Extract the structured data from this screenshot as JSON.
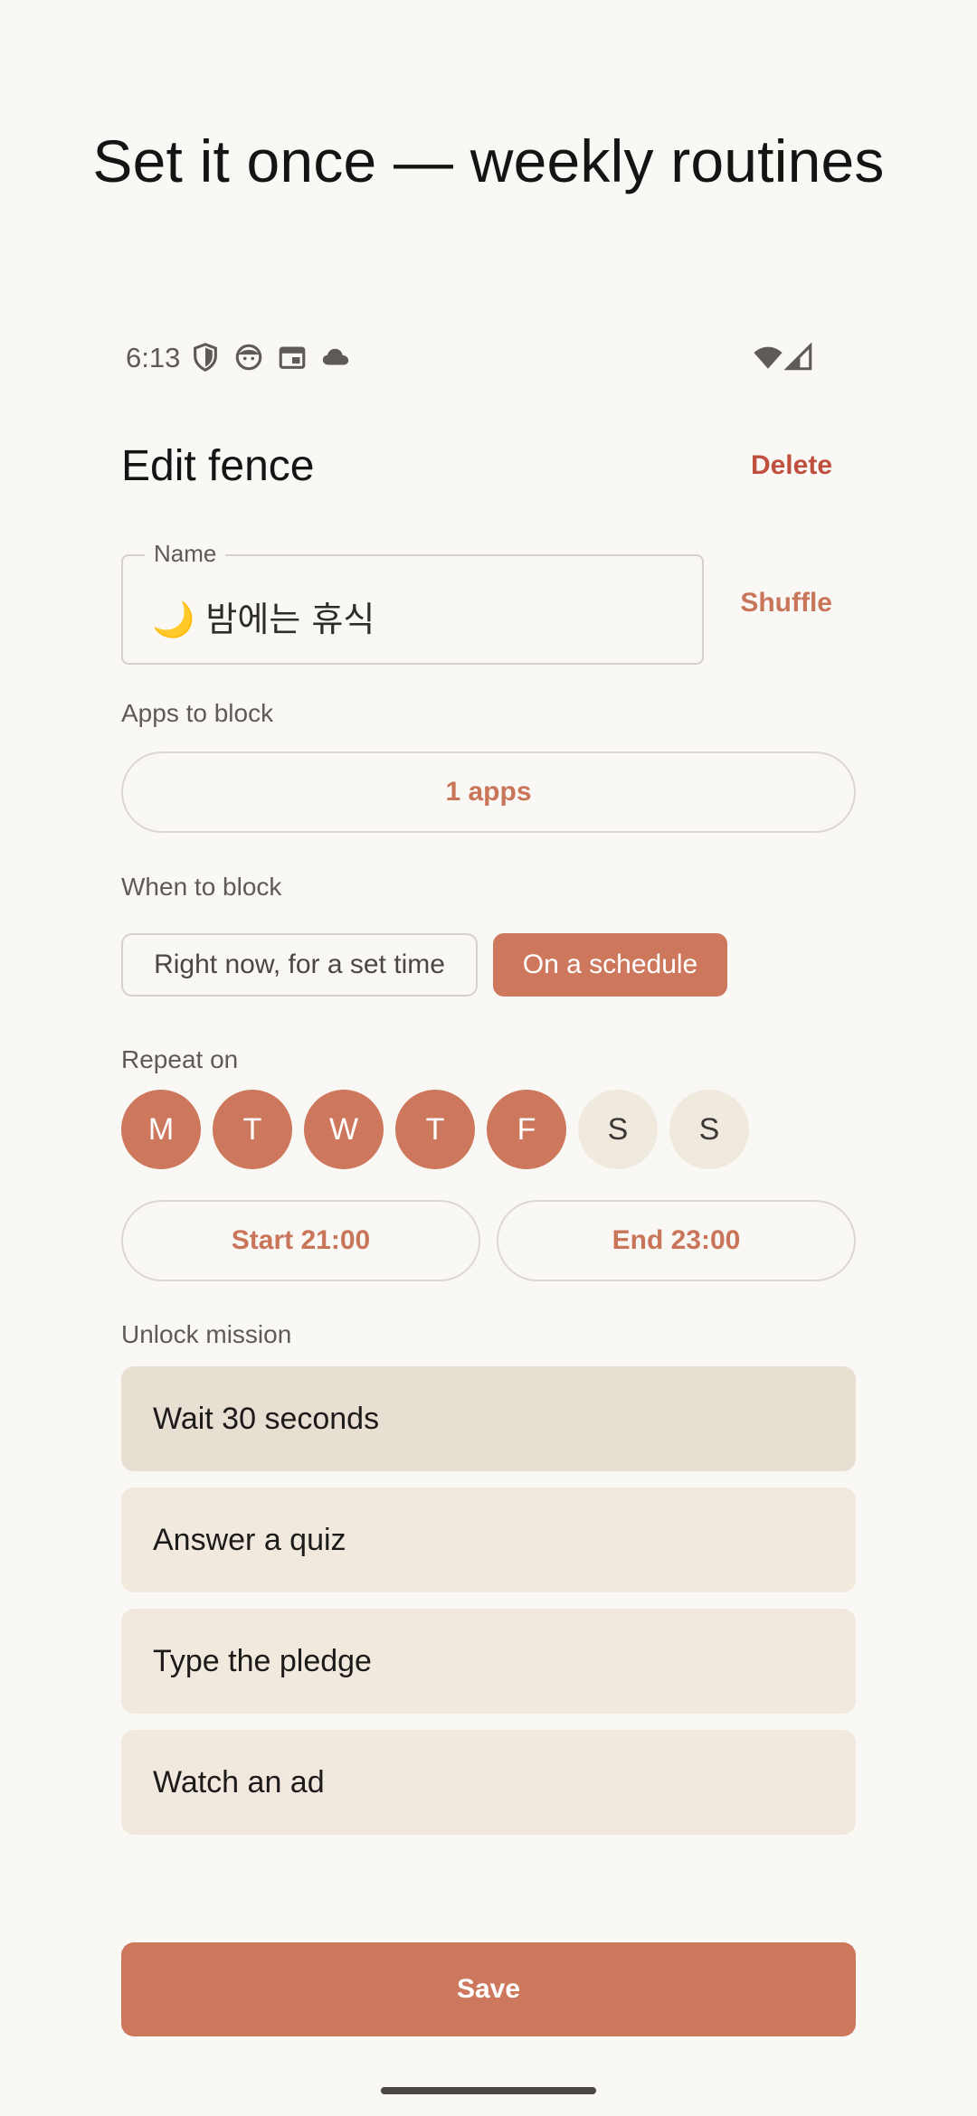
{
  "headline": "Set it once — weekly routines",
  "status_bar": {
    "time": "6:13",
    "left_icons": [
      "shield-icon",
      "face-icon",
      "calendar-icon",
      "cloud-icon"
    ],
    "right_icons": [
      "wifi-icon",
      "signal-icon"
    ]
  },
  "header": {
    "title": "Edit fence",
    "delete_label": "Delete"
  },
  "name_field": {
    "label": "Name",
    "value": "🌙 밤에는 휴식",
    "shuffle_label": "Shuffle"
  },
  "apps": {
    "section_label": "Apps to block",
    "button_label": "1 apps"
  },
  "when": {
    "section_label": "When to block",
    "options": [
      "Right now, for a set time",
      "On a schedule"
    ],
    "selected": "On a schedule"
  },
  "repeat": {
    "section_label": "Repeat on",
    "days": [
      {
        "label": "M",
        "selected": true
      },
      {
        "label": "T",
        "selected": true
      },
      {
        "label": "W",
        "selected": true
      },
      {
        "label": "T",
        "selected": true
      },
      {
        "label": "F",
        "selected": true
      },
      {
        "label": "S",
        "selected": false
      },
      {
        "label": "S",
        "selected": false
      }
    ]
  },
  "times": {
    "start_label": "Start 21:00",
    "end_label": "End 23:00"
  },
  "mission": {
    "section_label": "Unlock mission",
    "options": [
      "Wait 30 seconds",
      "Answer a quiz",
      "Type the pledge",
      "Watch an ad"
    ],
    "selected": "Wait 30 seconds"
  },
  "save_label": "Save",
  "colors": {
    "accent": "#cd785d",
    "danger": "#c0503e",
    "background": "#faf8f5"
  }
}
